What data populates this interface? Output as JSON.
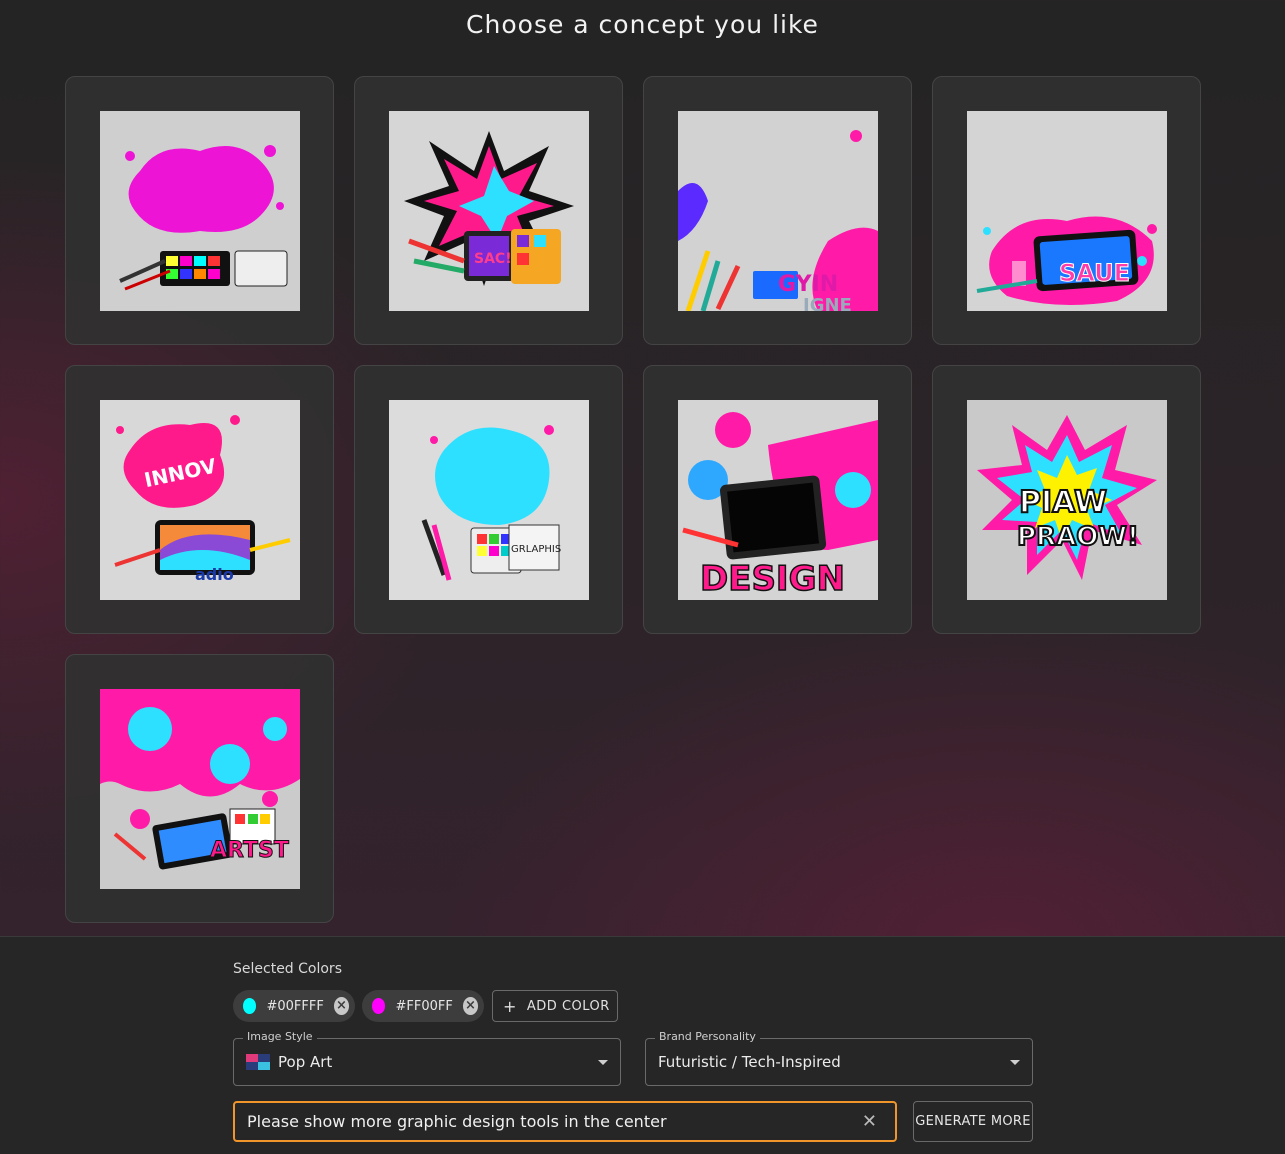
{
  "header": {
    "title": "Choose a concept you like"
  },
  "concepts": [
    {
      "label": ""
    },
    {
      "label": "SAC!"
    },
    {
      "label": "GYIN"
    },
    {
      "label": "SAUE"
    },
    {
      "label": "INNOV"
    },
    {
      "label": "GRLAPHIS"
    },
    {
      "label": "DESIGN"
    },
    {
      "label": "PIAW PRAOW!"
    },
    {
      "label": "ARTST"
    }
  ],
  "panel": {
    "selected_colors_label": "Selected Colors",
    "colors": [
      {
        "hex": "#00FFFF",
        "label": "#00FFFF"
      },
      {
        "hex": "#FF00FF",
        "label": "#FF00FF"
      }
    ],
    "add_color_label": "ADD COLOR",
    "image_style": {
      "legend": "Image Style",
      "value": "Pop Art"
    },
    "brand_personality": {
      "legend": "Brand Personality",
      "value": "Futuristic / Tech-Inspired"
    },
    "prompt_value": "Please show more graphic design tools in the center",
    "generate_more_label": "GENERATE MORE"
  },
  "colors": {
    "accent_orange": "#f0952a",
    "cyan": "#00ffff",
    "magenta": "#ff00ff"
  }
}
